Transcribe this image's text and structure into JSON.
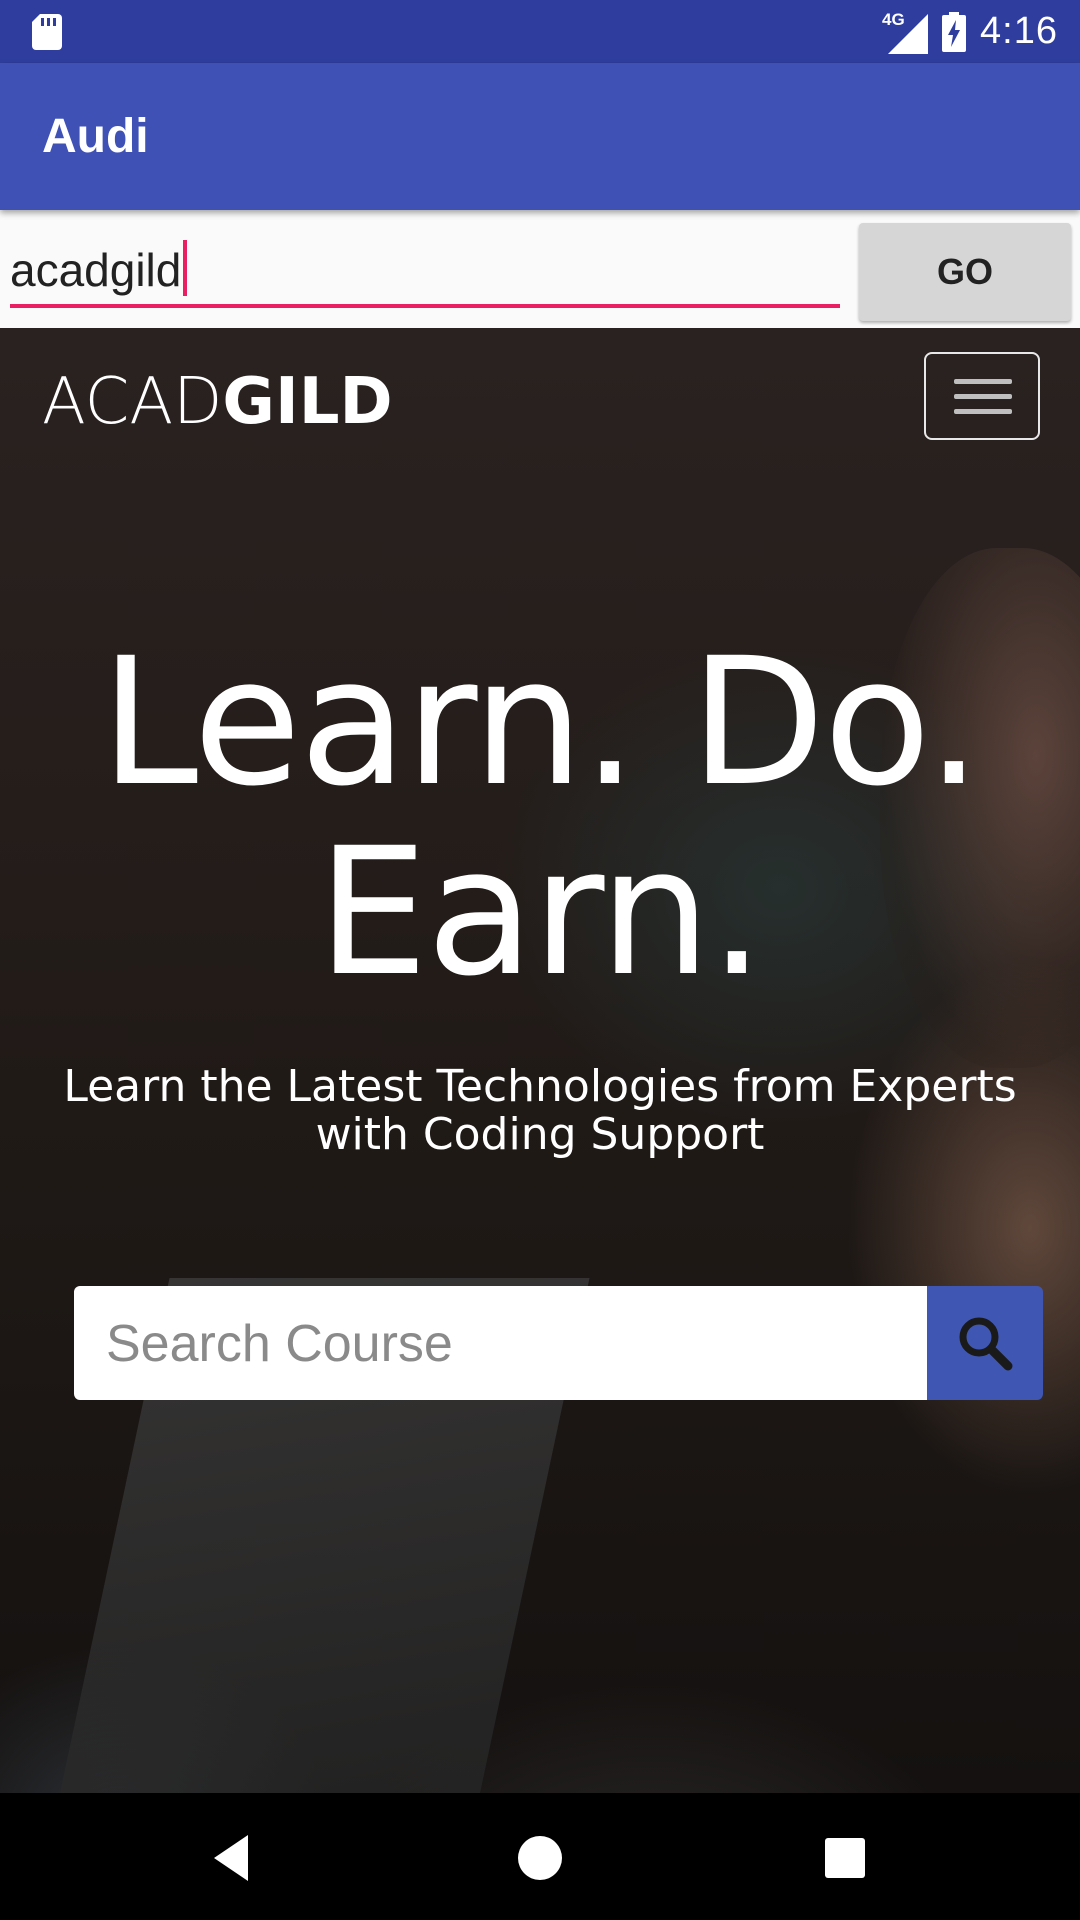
{
  "status_bar": {
    "network": "4G",
    "time": "4:16",
    "icons": [
      "sd-card-icon",
      "signal-icon",
      "battery-charging-icon"
    ]
  },
  "app_bar": {
    "title": "Audi"
  },
  "url_bar": {
    "value": "acadgild",
    "go_label": "GO"
  },
  "web": {
    "logo_light": "ACAD",
    "logo_bold": "GILD",
    "headline_line1": "Learn. Do.",
    "headline_line2": "Earn.",
    "subhead": "Learn the Latest Technologies from Experts with Coding Support",
    "search_placeholder": "Search Course"
  },
  "nav_bar": {
    "buttons": [
      "back-icon",
      "home-icon",
      "recents-icon"
    ]
  },
  "colors": {
    "status_bar": "#2f3e9e",
    "app_bar": "#3f51b5",
    "input_accent": "#e91e63",
    "search_button": "#3f57b3"
  }
}
